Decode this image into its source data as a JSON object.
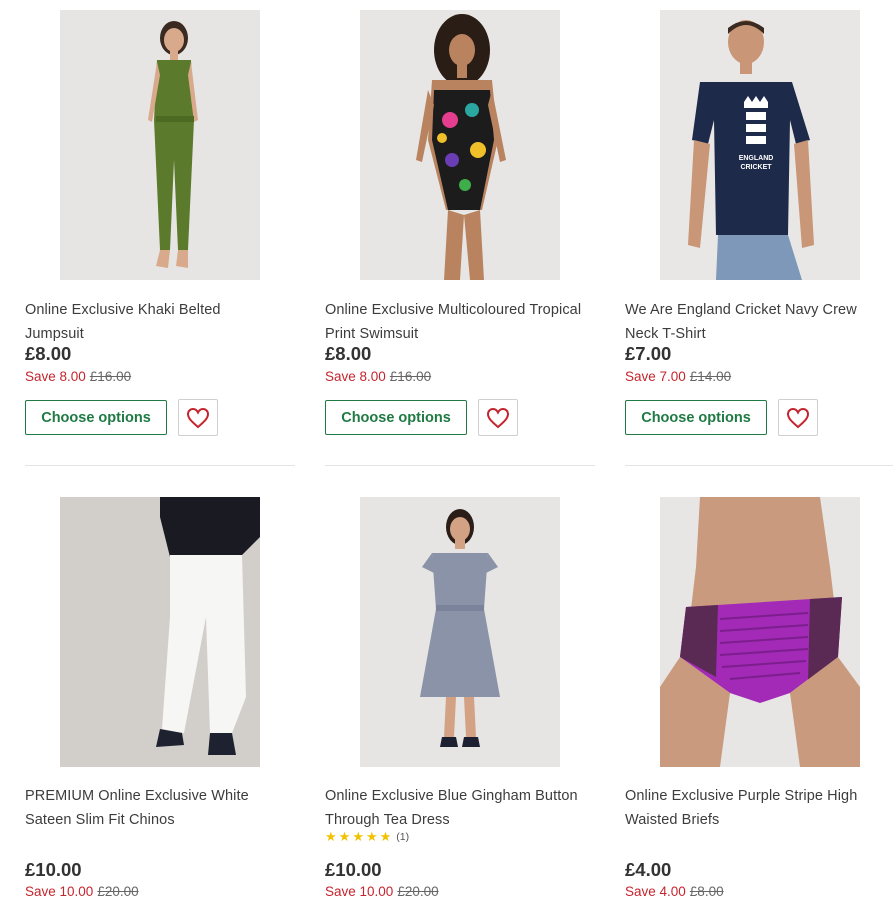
{
  "theme": {
    "accent": "#1f7a43",
    "save_color": "#c4252e",
    "star_color": "#f2c200"
  },
  "products": [
    {
      "title_line1": "Online Exclusive Khaki Belted",
      "title_line2": "Jumpsuit",
      "price": "£8.00",
      "save": "Save 8.00",
      "was": "£16.00",
      "button": "Choose options",
      "wishlist_icon": "heart-icon"
    },
    {
      "title_line1": "Online Exclusive Multicoloured Tropical",
      "title_line2": "Print Swimsuit",
      "price": "£8.00",
      "save": "Save 8.00",
      "was": "£16.00",
      "button": "Choose options",
      "wishlist_icon": "heart-icon"
    },
    {
      "title_line1": "We Are England Cricket Navy Crew",
      "title_line2": "Neck T-Shirt",
      "price": "£7.00",
      "save": "Save 7.00",
      "was": "£14.00",
      "button": "Choose options",
      "wishlist_icon": "heart-icon"
    },
    {
      "title_line1": "PREMIUM Online Exclusive White",
      "title_line2": "Sateen Slim Fit Chinos",
      "price": "£10.00",
      "save": "Save 10.00",
      "was": "£20.00"
    },
    {
      "title_line1": "Online Exclusive Blue Gingham Button",
      "title_line2": "Through Tea Dress",
      "rating_count": "(1)",
      "rating": 5,
      "price": "£10.00",
      "save": "Save 10.00",
      "was": "£20.00"
    },
    {
      "title_line1": "Online Exclusive Purple Stripe High",
      "title_line2": "Waisted Briefs",
      "price": "£4.00",
      "save": "Save 4.00",
      "was": "£8.00"
    }
  ],
  "tshirt_print": {
    "line1": "ENGLAND",
    "line2": "CRICKET"
  }
}
